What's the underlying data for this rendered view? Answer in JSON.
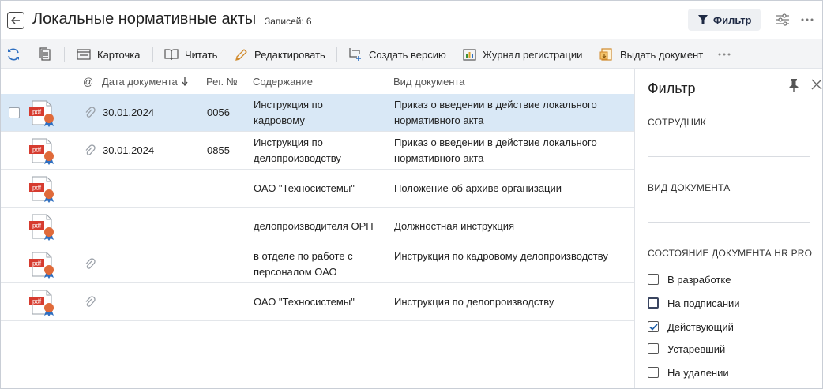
{
  "header": {
    "title": "Локальные нормативные акты",
    "records_label": "Записей:",
    "records_count": "6",
    "filter_button": "Фильтр"
  },
  "toolbar": {
    "items": [
      {
        "label": "Карточка",
        "icon": "card-icon"
      },
      {
        "label": "Читать",
        "icon": "book-icon"
      },
      {
        "label": "Редактировать",
        "icon": "pencil-icon"
      },
      {
        "label": "Создать версию",
        "icon": "new-version-icon"
      },
      {
        "label": "Журнал регистрации",
        "icon": "chart-journal-icon"
      },
      {
        "label": "Выдать документ",
        "icon": "issue-document-icon"
      }
    ]
  },
  "table": {
    "columns": {
      "attach": "@",
      "date": "Дата документа",
      "reg": "Рег. №",
      "content": "Содержание",
      "doc_type": "Вид документа"
    },
    "rows": [
      {
        "date": "30.01.2024",
        "reg": "0056",
        "content_1": "Инструкция по",
        "content_2": "кадровому",
        "type_1": "Приказ о введении в действие локального",
        "type_2": "нормативного акта",
        "clip": true,
        "selected": true
      },
      {
        "date": "30.01.2024",
        "reg": "0855",
        "content_1": "Инструкция по",
        "content_2": "делопроизводству",
        "type_1": "Приказ о введении в действие локального",
        "type_2": "нормативного акта",
        "clip": true,
        "selected": false
      },
      {
        "date": "",
        "reg": "",
        "content_1": "ОАО \"Техносистемы\"",
        "content_2": "",
        "type_1": "Положение об архиве организации",
        "type_2": "",
        "clip": false,
        "selected": false
      },
      {
        "date": "",
        "reg": "",
        "content_1": "делопроизводителя ОРП",
        "content_2": "",
        "type_1": "Должностная инструкция",
        "type_2": "",
        "clip": false,
        "selected": false
      },
      {
        "date": "",
        "reg": "",
        "content_1": "в отделе по работе с",
        "content_2": "персоналом ОАО",
        "type_1": "Инструкция по кадровому делопроизводству",
        "type_2": "",
        "clip": true,
        "selected": false
      },
      {
        "date": "",
        "reg": "",
        "content_1": "ОАО \"Техносистемы\"",
        "content_2": "",
        "type_1": "Инструкция по делопроизводству",
        "type_2": "",
        "clip": true,
        "selected": false
      }
    ],
    "pdf_label": "pdf"
  },
  "filter_panel": {
    "title": "Фильтр",
    "employee_label": "СОТРУДНИК",
    "doc_type_label": "ВИД ДОКУМЕНТА",
    "state_label": "СОСТОЯНИЕ ДОКУМЕНТА HR PRO",
    "options": [
      {
        "label": "В разработке",
        "checked": false
      },
      {
        "label": "На подписании",
        "checked": false
      },
      {
        "label": "Действующий",
        "checked": true
      },
      {
        "label": "Устаревший",
        "checked": false
      },
      {
        "label": "На удалении",
        "checked": false
      }
    ]
  },
  "colors": {
    "selected_row": "#d9e8f6",
    "pdf_red": "#d63b2f",
    "check_blue": "#1f5fa8"
  }
}
